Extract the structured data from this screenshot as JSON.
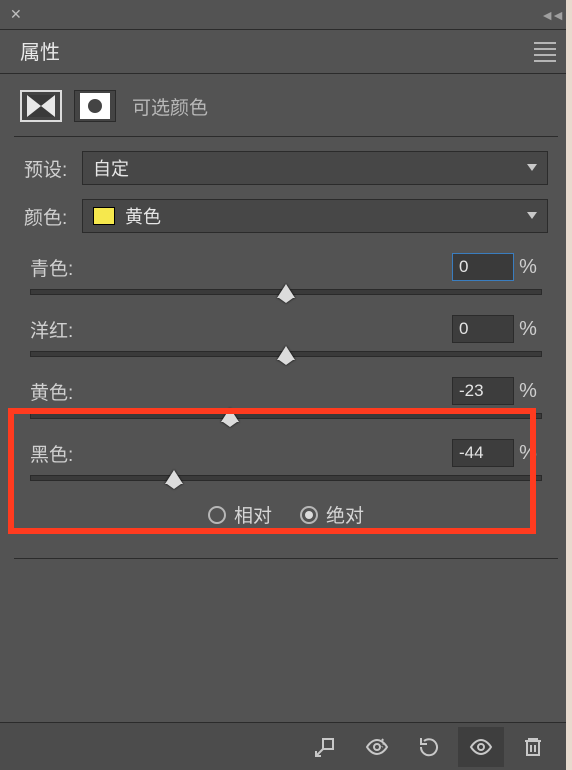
{
  "panel": {
    "tab_label": "属性",
    "adjustment_title": "可选颜色"
  },
  "preset": {
    "label": "预设:",
    "value": "自定"
  },
  "color": {
    "label": "颜色:",
    "value": "黄色",
    "swatch_hex": "#f6e84d"
  },
  "sliders": [
    {
      "label": "青色:",
      "value": "0",
      "thumb_pct": 50,
      "active": true
    },
    {
      "label": "洋红:",
      "value": "0",
      "thumb_pct": 50,
      "active": false
    },
    {
      "label": "黄色:",
      "value": "-23",
      "thumb_pct": 39,
      "active": false
    },
    {
      "label": "黑色:",
      "value": "-44",
      "thumb_pct": 28,
      "active": false
    }
  ],
  "method": {
    "relative_label": "相对",
    "absolute_label": "绝对",
    "selected": "absolute"
  },
  "percent_sign": "%"
}
